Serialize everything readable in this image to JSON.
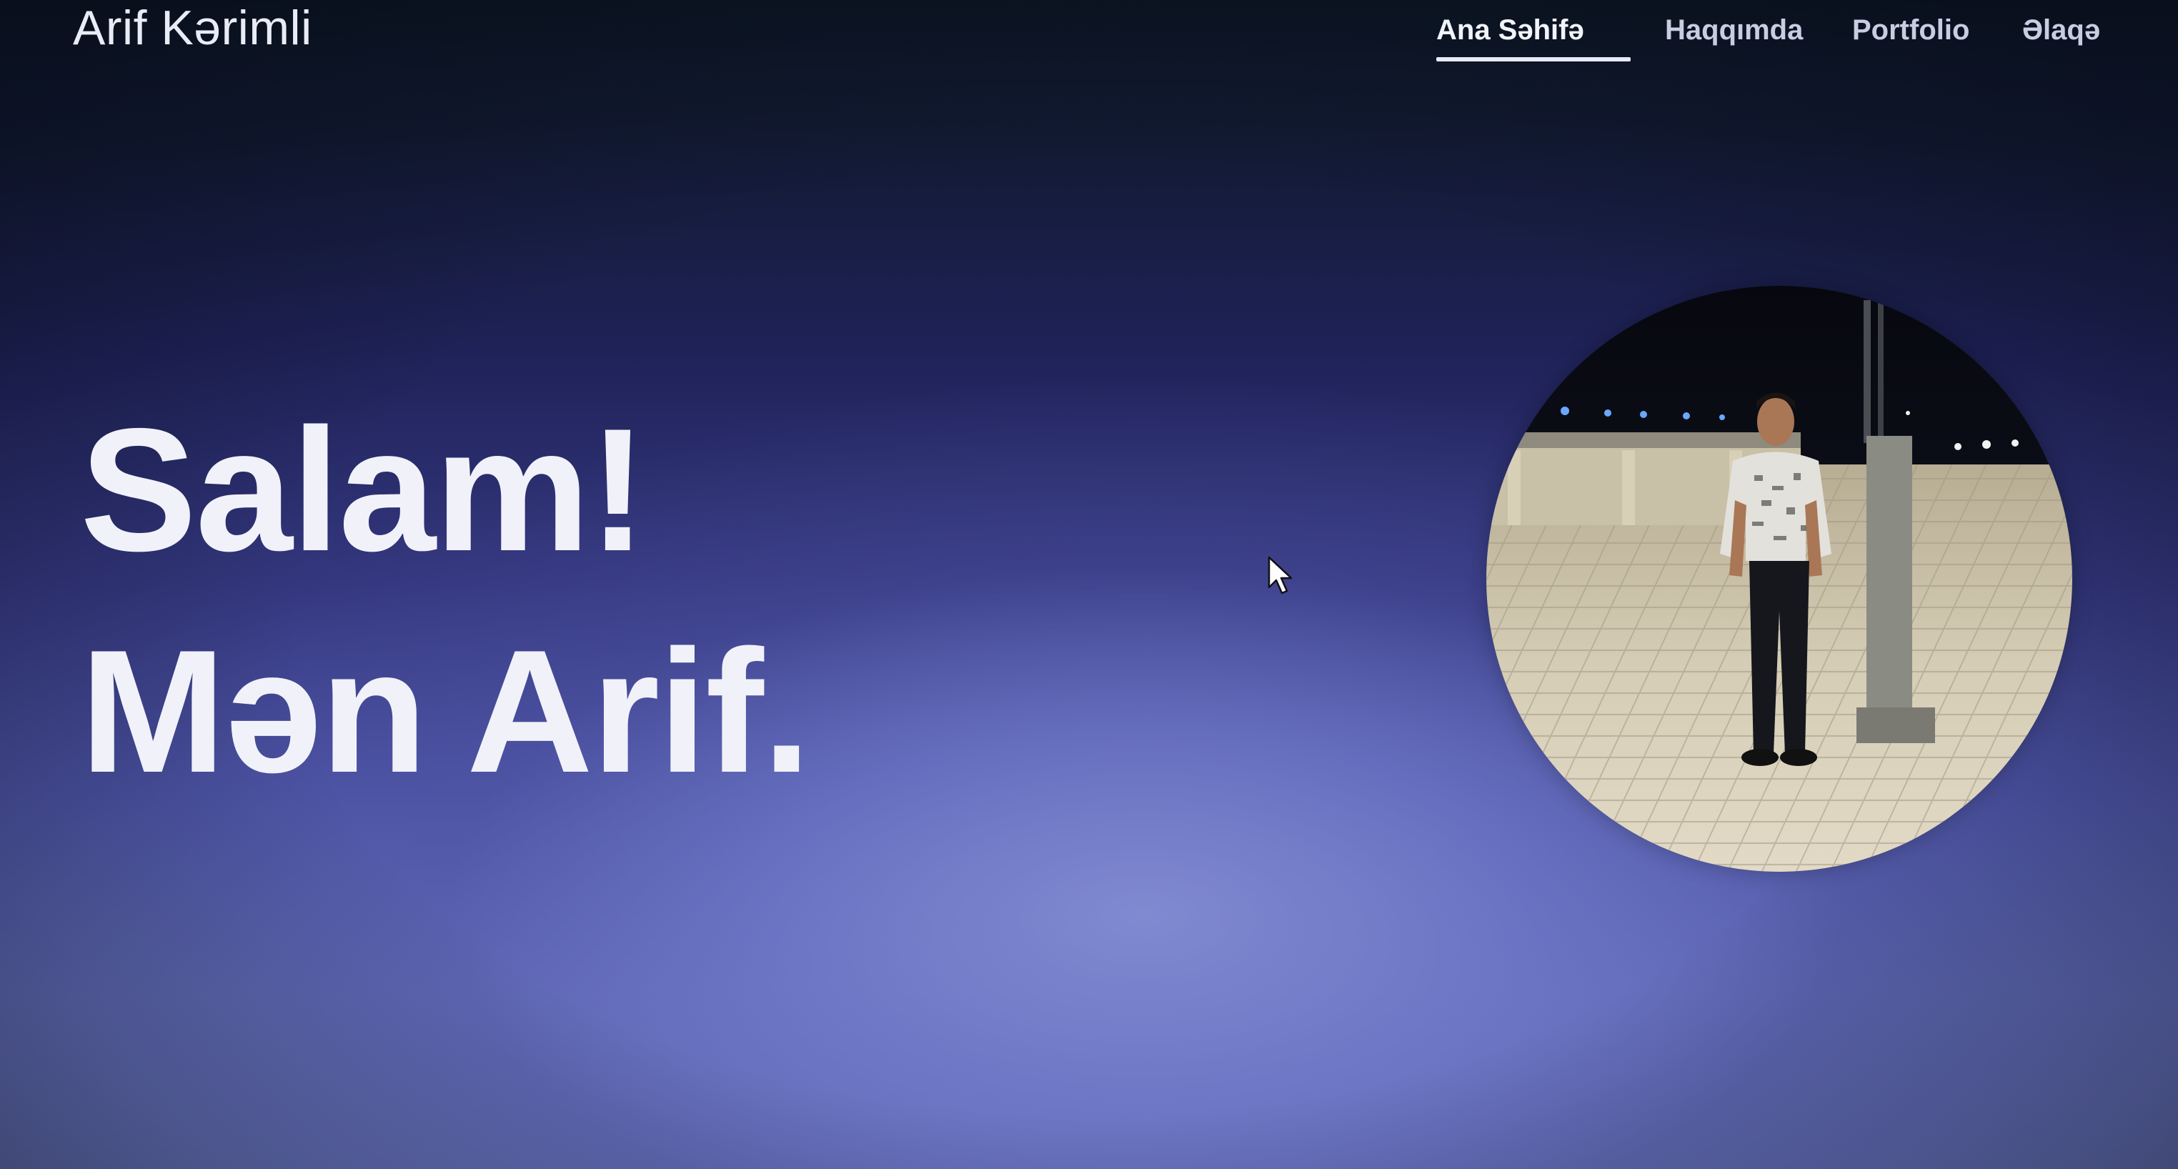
{
  "header": {
    "brand": "Arif Kərimli"
  },
  "nav": {
    "items": [
      {
        "label": "Ana Səhifə",
        "active": true
      },
      {
        "label": "Haqqımda",
        "active": false
      },
      {
        "label": "Portfolio",
        "active": false
      },
      {
        "label": "Əlaqə",
        "active": false
      }
    ]
  },
  "hero": {
    "line1": "Salam!",
    "line2": "Mən Arif."
  },
  "profile_photo": {
    "icon": "profile-photo"
  },
  "colors": {
    "text": "#f1f2f9",
    "nav_text": "#c9cde2",
    "accent_underline": "#e8ebf7",
    "bg_top": "#0c1623",
    "bg_bottom": "#6d79c2"
  }
}
